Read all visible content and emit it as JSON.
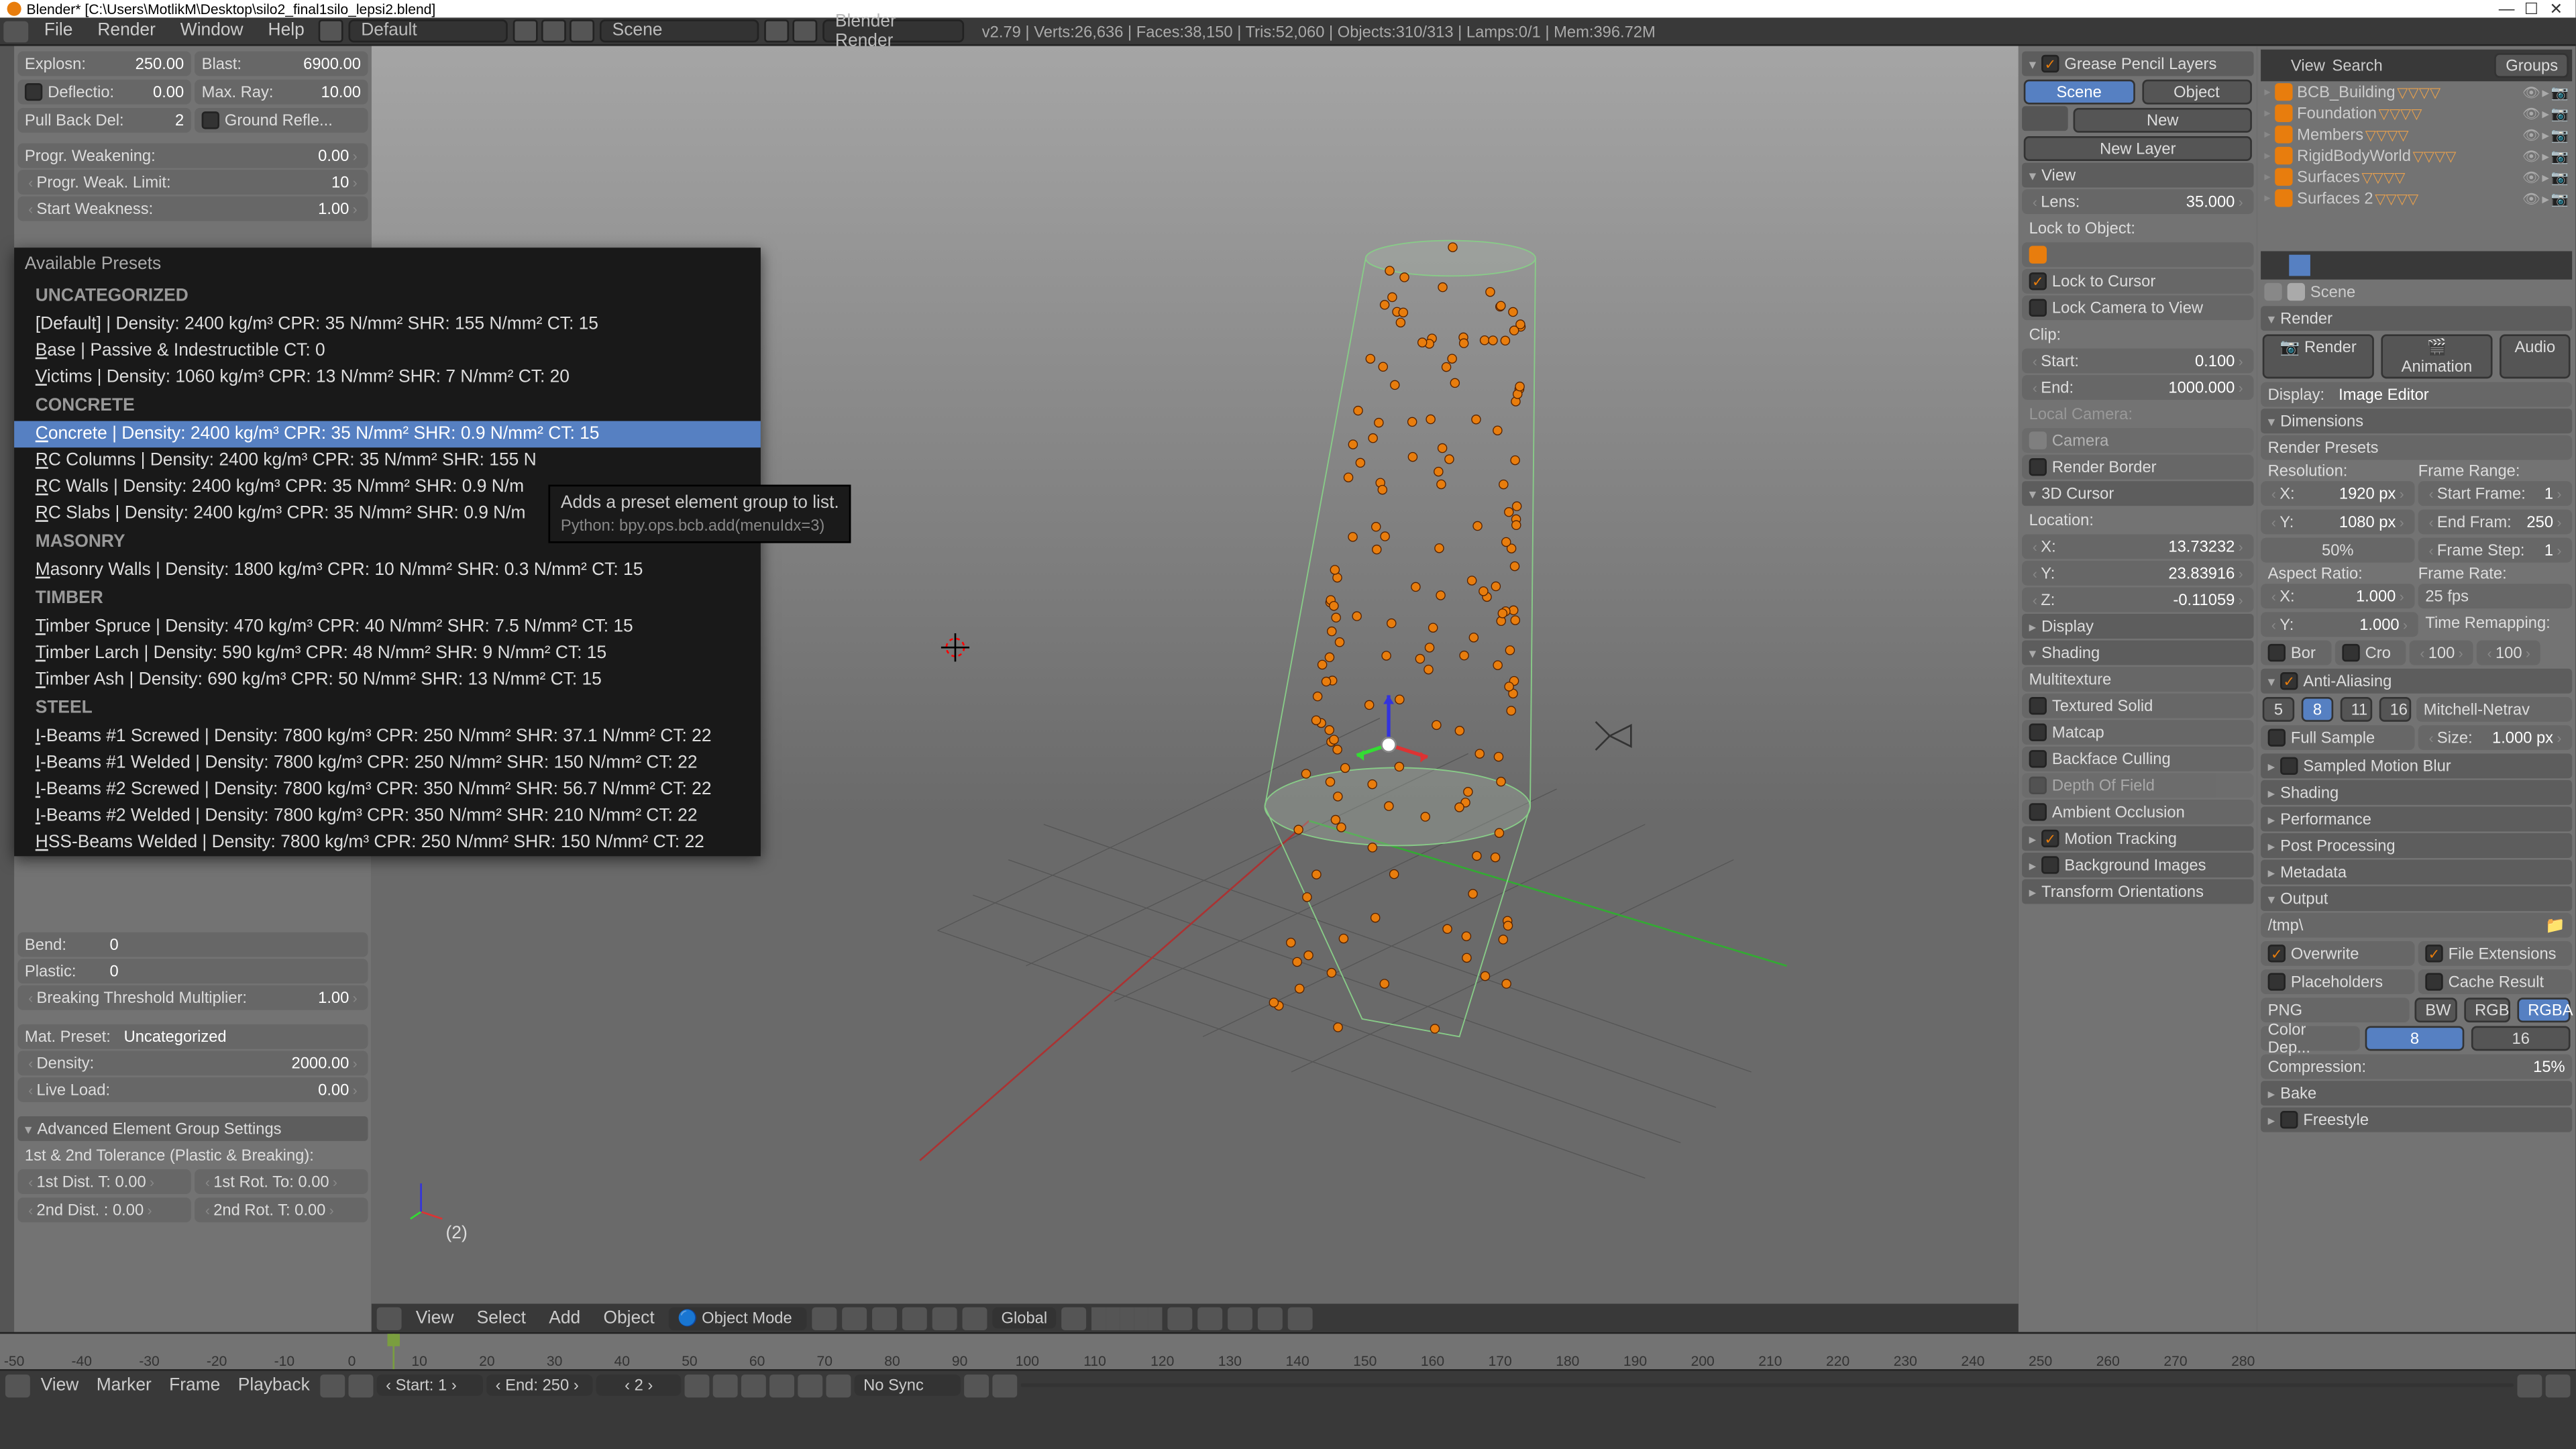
{
  "title": "Blender* [C:\\Users\\MotlikM\\Desktop\\silo2_final1silo_lepsi2.blend]",
  "menu": {
    "items": [
      "File",
      "Render",
      "Window",
      "Help"
    ],
    "layout": "Default",
    "scene": "Scene",
    "renderer": "Blender Render"
  },
  "stats": "v2.79 | Verts:26,636 | Faces:38,150 | Tris:52,060 | Objects:310/313 | Lamps:0/1 | Mem:396.72M",
  "left": {
    "rows": [
      {
        "l": "Explosn:",
        "v": "250.00",
        "l2": "Blast:",
        "v2": "6900.00"
      },
      {
        "l": "Deflectio:",
        "v": "0.00",
        "l2": "Max. Ray:",
        "v2": "10.00"
      },
      {
        "l": "Pull Back Del:",
        "v": "2",
        "l2": "Ground Refle..."
      }
    ],
    "progr_weakening_l": "Progr. Weakening:",
    "progr_weakening_v": "0.00",
    "progr_weak_limit_l": "Progr. Weak. Limit:",
    "progr_weak_limit_v": "10",
    "start_weakness_l": "Start Weakness:",
    "start_weakness_v": "1.00",
    "bend_l": "Bend:",
    "bend_v": "0",
    "plastic_l": "Plastic:",
    "plastic_v": "0",
    "btm_l": "Breaking Threshold Multiplier:",
    "btm_v": "1.00",
    "mat_preset_l": "Mat. Preset:",
    "mat_preset_v": "Uncategorized",
    "density_l": "Density:",
    "density_v": "2000.00",
    "live_load_l": "Live Load:",
    "live_load_v": "0.00",
    "aegs": "Advanced Element Group Settings",
    "tolerance": "1st & 2nd Tolerance (Plastic & Breaking):",
    "tol_rows": [
      {
        "a": "1st Dist. T: 0.00",
        "b": "1st Rot. To: 0.00"
      },
      {
        "a": "2nd Dist. : 0.00",
        "b": "2nd Rot. T: 0.00"
      }
    ]
  },
  "presets": {
    "title": "Available Presets",
    "groups": [
      {
        "name": "UNCATEGORIZED",
        "items": [
          "[Default]  |  Density: 2400 kg/m³     CPR: 35 N/mm²     SHR: 155 N/mm²     CT: 15",
          "Base  |  Passive & Indestructible     CT: 0",
          "Victims  |  Density: 1060 kg/m³     CPR: 13 N/mm²     SHR: 7 N/mm²     CT: 20"
        ]
      },
      {
        "name": "CONCRETE",
        "items": [
          "Concrete  |  Density: 2400 kg/m³     CPR: 35 N/mm²     SHR: 0.9 N/mm²     CT: 15",
          "RC Columns  |  Density: 2400 kg/m³     CPR: 35 N/mm²     SHR: 155 N",
          "RC Walls  |  Density: 2400 kg/m³     CPR: 35 N/mm²     SHR: 0.9 N/m",
          "RC Slabs  |  Density: 2400 kg/m³     CPR: 35 N/mm²     SHR: 0.9 N/m"
        ],
        "selected": 0
      },
      {
        "name": "MASONRY",
        "items": [
          "Masonry Walls  |  Density: 1800 kg/m³     CPR: 10 N/mm²     SHR: 0.3 N/mm²     CT: 15"
        ]
      },
      {
        "name": "TIMBER",
        "items": [
          "Timber Spruce  |  Density: 470 kg/m³     CPR: 40 N/mm²     SHR: 7.5 N/mm²     CT: 15",
          "Timber Larch  |  Density: 590 kg/m³     CPR: 48 N/mm²     SHR: 9 N/mm²     CT: 15",
          "Timber Ash  |  Density: 690 kg/m³     CPR: 50 N/mm²     SHR: 13 N/mm²     CT: 15"
        ]
      },
      {
        "name": "STEEL",
        "items": [
          "I-Beams #1 Screwed  |  Density: 7800 kg/m³     CPR: 250 N/mm²     SHR: 37.1 N/mm²     CT: 22",
          "I-Beams #1 Welded  |  Density: 7800 kg/m³     CPR: 250 N/mm²     SHR: 150 N/mm²     CT: 22",
          "I-Beams #2 Screwed  |  Density: 7800 kg/m³     CPR: 350 N/mm²     SHR: 56.7 N/mm²     CT: 22",
          "I-Beams #2 Welded  |  Density: 7800 kg/m³     CPR: 350 N/mm²     SHR: 210 N/mm²     CT: 22",
          "HSS-Beams Welded  |  Density: 7800 kg/m³     CPR: 250 N/mm²     SHR: 150 N/mm²     CT: 22"
        ]
      }
    ]
  },
  "tooltip": {
    "main": "Adds a preset element group to list.",
    "py": "Python: bpy.ops.bcb.add(menuIdx=3)"
  },
  "right1": {
    "gpl": "Grease Pencil Layers",
    "scene_btn": "Scene",
    "object_btn": "Object",
    "new_btn": "New",
    "newlayer_btn": "New Layer",
    "view": "View",
    "lens_l": "Lens:",
    "lens_v": "35.000",
    "lock_obj": "Lock to Object:",
    "lock_cursor": "Lock to Cursor",
    "lock_cam": "Lock Camera to View",
    "clip": "Clip:",
    "start_l": "Start:",
    "start_v": "0.100",
    "end_l": "End:",
    "end_v": "1000.000",
    "local_cam": "Local Camera:",
    "camera": "Camera",
    "render_border": "Render Border",
    "cursor3d": "3D Cursor",
    "location": "Location:",
    "x": "X:",
    "xv": "13.73232",
    "y": "Y:",
    "yv": "23.83916",
    "z": "Z:",
    "zv": "-0.11059",
    "display": "Display",
    "shading": "Shading",
    "multitex": "Multitexture",
    "tex_solid": "Textured Solid",
    "matcap": "Matcap",
    "backface": "Backface Culling",
    "dof": "Depth Of Field",
    "ao": "Ambient Occlusion",
    "motion": "Motion Tracking",
    "bgimg": "Background Images",
    "transform": "Transform Orientations"
  },
  "outliner": {
    "view": "View",
    "search": "Search",
    "groups": "Groups",
    "items": [
      "BCB_Building",
      "Foundation",
      "Members",
      "RigidBodyWorld",
      "Surfaces",
      "Surfaces 2"
    ]
  },
  "props": {
    "scene": "Scene",
    "render": "Render",
    "render_btn": "Render",
    "anim_btn": "Animation",
    "audio_btn": "Audio",
    "display_l": "Display:",
    "display_v": "Image Editor",
    "dims": "Dimensions",
    "presets": "Render Presets",
    "resolution": "Resolution:",
    "framerange": "Frame Range:",
    "resx_l": "X:",
    "resx_v": "1920 px",
    "sf_l": "Start Frame:",
    "sf_v": "1",
    "resy_l": "Y:",
    "resy_v": "1080 px",
    "ef_l": "End Fram:",
    "ef_v": "250",
    "pct": "50%",
    "fs_l": "Frame Step:",
    "fs_v": "1",
    "aspect": "Aspect Ratio:",
    "framerate": "Frame Rate:",
    "ax_l": "X:",
    "ax_v": "1.000",
    "fps": "25 fps",
    "ay_l": "Y:",
    "ay_v": "1.000",
    "remap": "Time Remapping:",
    "bor": "Bor",
    "cro": "Cro",
    "r1": "100",
    "r2": "100",
    "aa": "Anti-Aliasing",
    "aa5": "5",
    "aa8": "8",
    "aa11": "11",
    "aa16": "16",
    "mn": "Mitchell-Netrav",
    "full": "Full Sample",
    "size_l": "Size:",
    "size_v": "1.000 px",
    "smb": "Sampled Motion Blur",
    "shading": "Shading",
    "perf": "Performance",
    "pp": "Post Processing",
    "meta": "Metadata",
    "output": "Output",
    "tmp": "/tmp\\",
    "overwrite": "Overwrite",
    "fileext": "File Extensions",
    "placeholders": "Placeholders",
    "cache": "Cache Result",
    "png": "PNG",
    "bw": "BW",
    "rgb": "RGB",
    "rgba": "RGBA",
    "cdep_l": "Color Dep...",
    "cd8": "8",
    "cd16": "16",
    "comp_l": "Compression:",
    "comp_v": "15%",
    "bake": "Bake",
    "freestyle": "Freestyle"
  },
  "vfooter": {
    "view": "View",
    "select": "Select",
    "add": "Add",
    "object": "Object",
    "mode": "Object Mode",
    "global": "Global"
  },
  "vp_label": "(2)",
  "timeline": {
    "ticks": [
      -50,
      -40,
      -30,
      -20,
      -10,
      0,
      10,
      20,
      30,
      40,
      50,
      60,
      70,
      80,
      90,
      100,
      110,
      120,
      130,
      140,
      150,
      160,
      170,
      180,
      190,
      200,
      210,
      220,
      230,
      240,
      250,
      260,
      270,
      280
    ],
    "view": "View",
    "marker": "Marker",
    "frame": "Frame",
    "playback": "Playback",
    "start_l": "Start:",
    "start_v": "1",
    "end_l": "End:",
    "end_v": "250",
    "cur": "2",
    "sync": "No Sync"
  }
}
